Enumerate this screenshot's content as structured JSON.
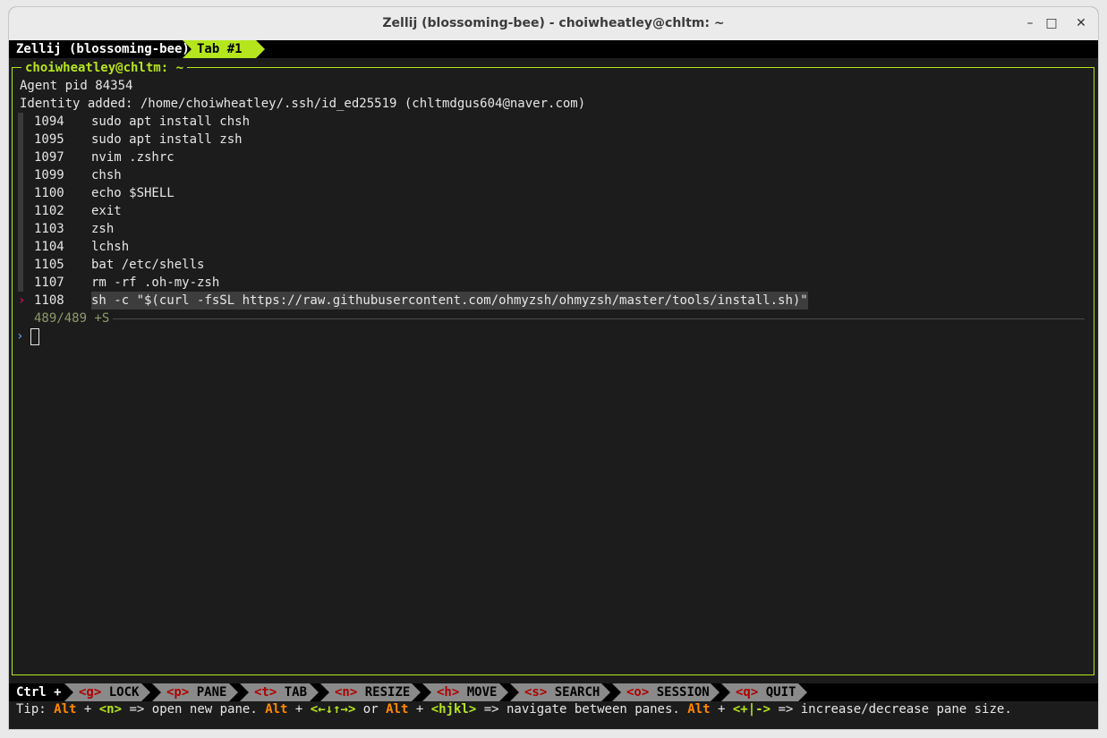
{
  "window": {
    "title": "Zellij (blossoming-bee) - choiwheatley@chltm: ~"
  },
  "window_controls": {
    "minimize": "–",
    "maximize": "□",
    "close": "✕"
  },
  "tabbar": {
    "session": "Zellij (blossoming-bee)",
    "active_tab": "Tab #1"
  },
  "pane": {
    "title": "choiwheatley@chltm: ~",
    "lines": [
      "Agent pid 84354",
      "Identity added: /home/choiwheatley/.ssh/id_ed25519 (chltmdgus604@naver.com)"
    ],
    "history": [
      {
        "num": "1094",
        "cmd": "sudo apt install chsh"
      },
      {
        "num": "1095",
        "cmd": "sudo apt install zsh"
      },
      {
        "num": "1097",
        "cmd": "nvim .zshrc"
      },
      {
        "num": "1099",
        "cmd": "chsh"
      },
      {
        "num": "1100",
        "cmd": "echo $SHELL"
      },
      {
        "num": "1102",
        "cmd": "exit"
      },
      {
        "num": "1103",
        "cmd": "zsh"
      },
      {
        "num": "1104",
        "cmd": "lchsh"
      },
      {
        "num": "1105",
        "cmd": "bat /etc/shells"
      },
      {
        "num": "1107",
        "cmd": "rm -rf .oh-my-zsh"
      }
    ],
    "selected": {
      "marker": "›",
      "num": "1108",
      "cmd": "sh -c \"$(curl -fsSL https://raw.githubusercontent.com/ohmyzsh/ohmyzsh/master/tools/install.sh)\""
    },
    "count": "489/489 +S",
    "prompt": "›"
  },
  "statusbar": {
    "modifier": "Ctrl +",
    "keys": [
      {
        "key": "<g>",
        "label": "LOCK"
      },
      {
        "key": "<p>",
        "label": "PANE"
      },
      {
        "key": "<t>",
        "label": "TAB"
      },
      {
        "key": "<n>",
        "label": "RESIZE"
      },
      {
        "key": "<h>",
        "label": "MOVE"
      },
      {
        "key": "<s>",
        "label": "SEARCH"
      },
      {
        "key": "<o>",
        "label": "SESSION"
      },
      {
        "key": "<q>",
        "label": "QUIT"
      }
    ]
  },
  "tip": {
    "prefix": "Tip: ",
    "alt": "Alt",
    "plus": " + ",
    "k1": "<n>",
    "t1": " => open new pane. ",
    "k2": "<←↓↑→>",
    "t2": " or ",
    "k3": "<hjkl>",
    "t3": " => navigate between panes. ",
    "k4": "<+|->",
    "t4": " => increase/decrease pane size."
  }
}
